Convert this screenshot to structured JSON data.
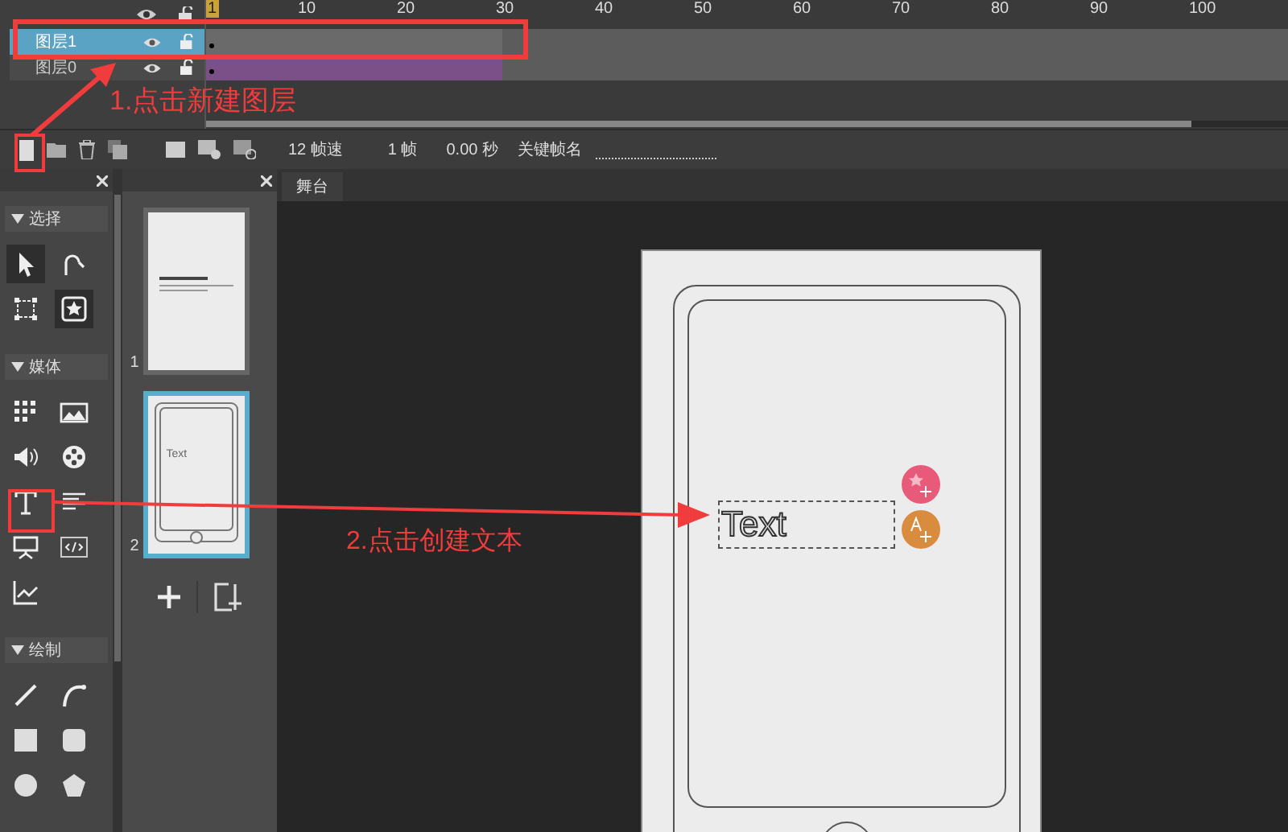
{
  "timeline": {
    "ruler": [
      "1",
      "10",
      "20",
      "30",
      "40",
      "50",
      "60",
      "70",
      "80",
      "90",
      "100"
    ],
    "layers": [
      {
        "name": "图层1",
        "selected": true,
        "color": "#6a6a6a"
      },
      {
        "name": "图层0",
        "selected": false,
        "color": "#7b4f88"
      }
    ],
    "scrollbar": {
      "level": 0.91
    },
    "toolbar": {
      "fps": "12 帧速",
      "frame": "1 帧",
      "time": "0.00 秒",
      "keyframe_label": "关键帧名"
    }
  },
  "tools": {
    "sections": [
      {
        "title": "选择",
        "tools": [
          {
            "kind": "pointer",
            "selected": true
          },
          {
            "kind": "bend",
            "selected": false
          },
          {
            "kind": "transform",
            "selected": false
          },
          {
            "kind": "star",
            "selected": true
          }
        ]
      },
      {
        "title": "媒体",
        "tools": [
          {
            "kind": "grid",
            "selected": false
          },
          {
            "kind": "image",
            "selected": false
          },
          {
            "kind": "sound",
            "selected": false
          },
          {
            "kind": "film",
            "selected": false
          },
          {
            "kind": "text",
            "selected": false
          },
          {
            "kind": "paragraph",
            "selected": false
          },
          {
            "kind": "board",
            "selected": false
          },
          {
            "kind": "code",
            "selected": false
          },
          {
            "kind": "chart",
            "selected": false
          }
        ]
      },
      {
        "title": "绘制",
        "tools": [
          {
            "kind": "line",
            "selected": false
          },
          {
            "kind": "curve",
            "selected": false
          },
          {
            "kind": "square",
            "selected": false
          },
          {
            "kind": "rounded",
            "selected": false
          },
          {
            "kind": "circle",
            "selected": false
          },
          {
            "kind": "pentagon",
            "selected": false
          }
        ]
      }
    ]
  },
  "pages": [
    {
      "number": "1",
      "selected": false,
      "kind": "cover"
    },
    {
      "number": "2",
      "selected": true,
      "kind": "phone",
      "text": "Text"
    }
  ],
  "stage": {
    "tab": "舞台",
    "text_box": "Text"
  },
  "annotations": [
    "1.点击新建图层",
    "2.点击创建文本"
  ]
}
